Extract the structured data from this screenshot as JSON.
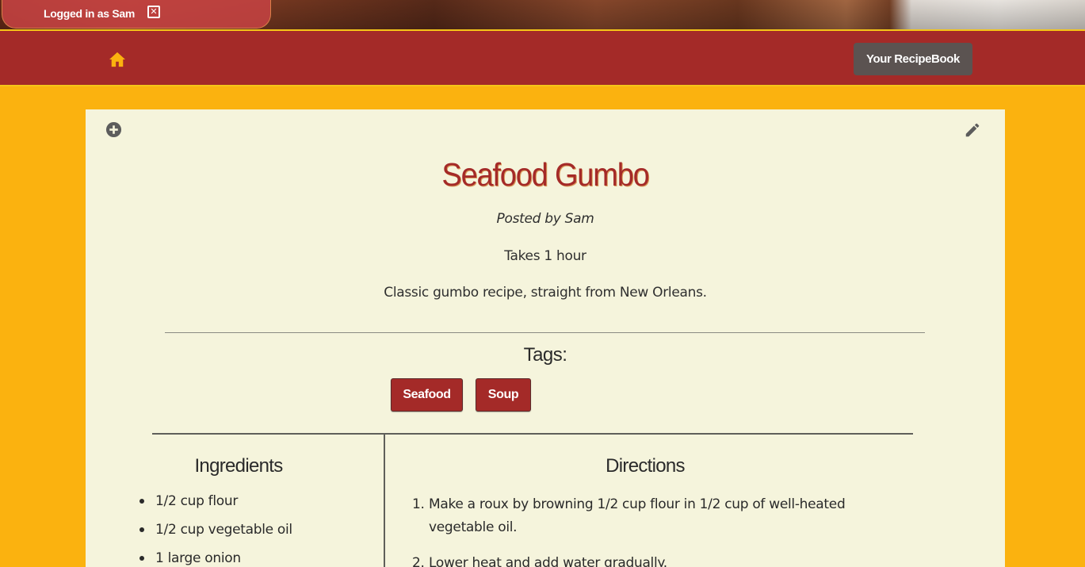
{
  "session": {
    "logged_in_text": "Logged in as Sam",
    "close_glyph": "✕"
  },
  "nav": {
    "home_icon": "home-icon",
    "recipebook_label": "Your RecipeBook"
  },
  "colors": {
    "page_background": "#fbb20f",
    "navbar": "#a42a28",
    "card": "#f5f4dc",
    "accent_red": "#a42a28",
    "button_gray": "#5b5351"
  },
  "recipe": {
    "title": "Seafood Gumbo",
    "posted_by": "Posted by Sam",
    "time": "Takes 1 hour",
    "description": "Classic gumbo recipe, straight from New Orleans.",
    "tags_heading": "Tags:",
    "tags": [
      "Seafood",
      "Soup"
    ],
    "ingredients_heading": "Ingredients",
    "ingredients": [
      "1/2 cup flour",
      "1/2 cup vegetable oil",
      "1 large onion"
    ],
    "directions_heading": "Directions",
    "directions": [
      {
        "num": "1.",
        "lines": [
          "Make a roux by browning 1/2 cup flour in 1/2 cup of well-heated",
          "vegetable oil."
        ]
      },
      {
        "num": "2.",
        "lines": [
          "Lower heat and add water gradually."
        ]
      }
    ]
  },
  "card_actions": {
    "add_icon": "plus-circle-icon",
    "edit_icon": "pencil-icon"
  }
}
